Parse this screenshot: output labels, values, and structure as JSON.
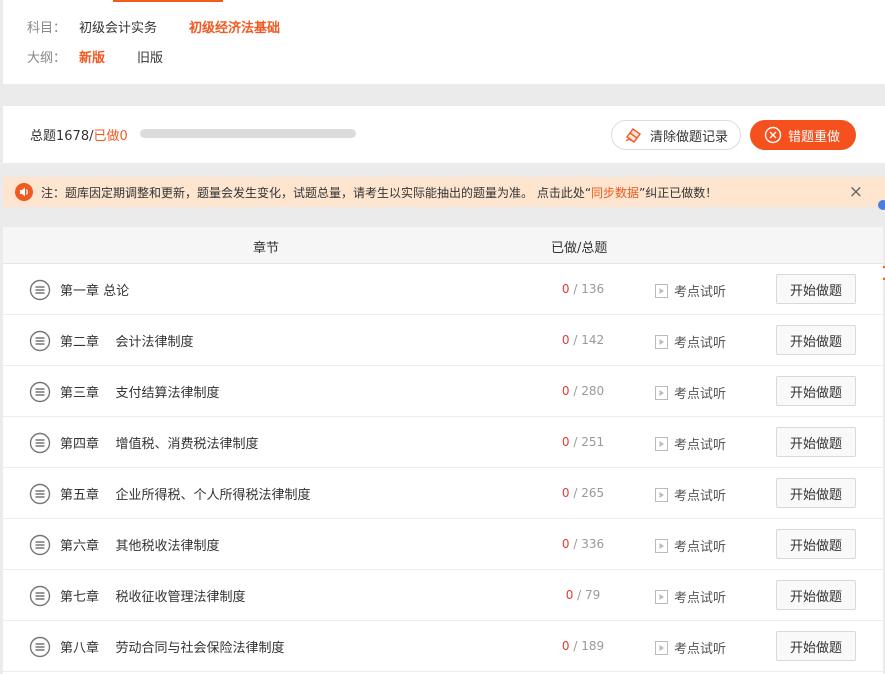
{
  "filters": {
    "subject_label": "科目：",
    "subjects": [
      "初级会计实务",
      "初级经济法基础"
    ],
    "active_subject": "初级经济法基础",
    "outline_label": "大纲：",
    "outlines": [
      "新版",
      "旧版"
    ],
    "active_outline": "新版"
  },
  "stats": {
    "total_text": "总题1678/",
    "done_text": "已做0",
    "progress_fraction": 0,
    "clear_label": "清除做题记录",
    "wrong_label": "错题重做"
  },
  "notice": {
    "text_prefix": "注：题库因定期调整和更新，题量会发生变化，试题总量，请考生以实际能抽出的题量为准。 点击此处“",
    "link": "同步数据",
    "text_suffix": "”纠正已做数！",
    "close": "×"
  },
  "table": {
    "headers": {
      "chapter": "章节",
      "progress": "已做/总题"
    },
    "listen_label": "考点试听",
    "start_label": "开始做题",
    "rows": [
      {
        "title": "第一章 总论",
        "done": "0",
        "sep": " / ",
        "total": "136"
      },
      {
        "title": "第二章    会计法律制度",
        "done": "0",
        "sep": " / ",
        "total": "142"
      },
      {
        "title": "第三章    支付结算法律制度",
        "done": "0",
        "sep": " / ",
        "total": "280"
      },
      {
        "title": "第四章    增值税、消费税法律制度",
        "done": "0",
        "sep": " / ",
        "total": "251"
      },
      {
        "title": "第五章    企业所得税、个人所得税法律制度",
        "done": "0",
        "sep": " / ",
        "total": "265"
      },
      {
        "title": "第六章    其他税收法律制度",
        "done": "0",
        "sep": " / ",
        "total": "336"
      },
      {
        "title": "第七章    税收征收管理法律制度",
        "done": "0",
        "sep": " / ",
        "total": "79"
      },
      {
        "title": "第八章    劳动合同与社会保险法律制度",
        "done": "0",
        "sep": " / ",
        "total": "189"
      }
    ]
  },
  "colors": {
    "accent": "#f05a22",
    "done": "#e53935",
    "notice_bg": "#fde5cf"
  }
}
